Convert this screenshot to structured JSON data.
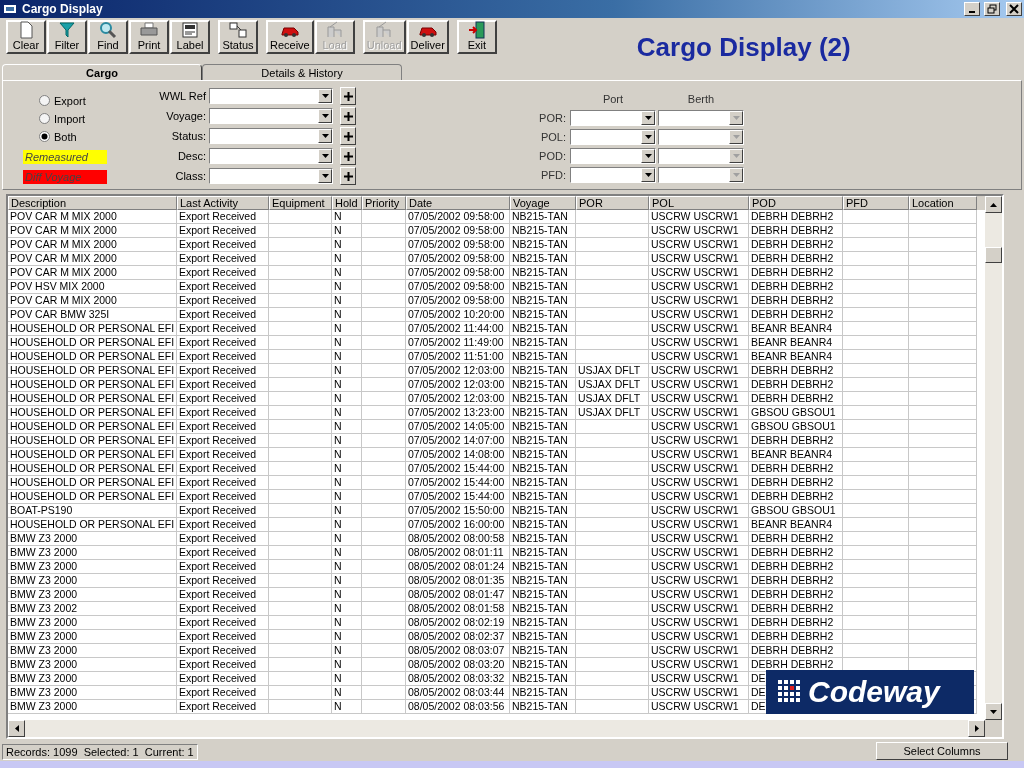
{
  "window": {
    "title": "Cargo Display"
  },
  "slide_title": "Cargo Display (2)",
  "toolbar": [
    {
      "buttons": [
        {
          "label": "Clear",
          "disabled": false
        },
        {
          "label": "Filter",
          "disabled": false
        },
        {
          "label": "Find",
          "disabled": false
        },
        {
          "label": "Print",
          "disabled": false
        },
        {
          "label": "Label",
          "disabled": false
        }
      ]
    },
    {
      "buttons": [
        {
          "label": "Status",
          "disabled": false
        }
      ]
    },
    {
      "buttons": [
        {
          "label": "Receive",
          "disabled": false
        },
        {
          "label": "Load",
          "disabled": true
        }
      ]
    },
    {
      "buttons": [
        {
          "label": "Unload",
          "disabled": true
        },
        {
          "label": "Deliver",
          "disabled": false
        }
      ]
    },
    {
      "buttons": [
        {
          "label": "Exit",
          "disabled": false
        }
      ]
    }
  ],
  "tabs": [
    {
      "label": "Cargo",
      "selected": true
    },
    {
      "label": "Details & History",
      "selected": false
    }
  ],
  "direction": [
    {
      "label": "Export",
      "selected": false
    },
    {
      "label": "Import",
      "selected": false
    },
    {
      "label": "Both",
      "selected": true
    }
  ],
  "legend": [
    {
      "label": "Remeasured",
      "color": "#ffff00"
    },
    {
      "label": "Diff Voyage",
      "color": "#ff0000"
    }
  ],
  "filters": [
    {
      "label": "WWL Ref"
    },
    {
      "label": "Voyage:"
    },
    {
      "label": "Status:"
    },
    {
      "label": "Desc:"
    },
    {
      "label": "Class:"
    }
  ],
  "ports": {
    "headers": [
      "Port",
      "Berth"
    ],
    "rows": [
      {
        "label": "POR:",
        "berth_disabled": true
      },
      {
        "label": "POL:",
        "berth_disabled": true
      },
      {
        "label": "POD:",
        "berth_disabled": true
      },
      {
        "label": "PFD:",
        "berth_disabled": true
      }
    ]
  },
  "table": {
    "columns": [
      "Description",
      "Last Activity",
      "Equipment",
      "Hold",
      "Priority",
      "Date",
      "Voyage",
      "POR",
      "POL",
      "POD",
      "PFD",
      "Location"
    ],
    "rows": [
      {
        "description": "POV CAR M MIX 2000",
        "last_activity": "Export Received",
        "hold": "N",
        "date": "07/05/2002 09:58:00",
        "voyage": "NB215-TAN",
        "pol": "USCRW USCRW1",
        "pod": "DEBRH DEBRH2"
      },
      {
        "description": "POV CAR M MIX 2000",
        "last_activity": "Export Received",
        "hold": "N",
        "date": "07/05/2002 09:58:00",
        "voyage": "NB215-TAN",
        "pol": "USCRW USCRW1",
        "pod": "DEBRH DEBRH2"
      },
      {
        "description": "POV CAR M MIX 2000",
        "last_activity": "Export Received",
        "hold": "N",
        "date": "07/05/2002 09:58:00",
        "voyage": "NB215-TAN",
        "pol": "USCRW USCRW1",
        "pod": "DEBRH DEBRH2"
      },
      {
        "description": "POV CAR M MIX 2000",
        "last_activity": "Export Received",
        "hold": "N",
        "date": "07/05/2002 09:58:00",
        "voyage": "NB215-TAN",
        "pol": "USCRW USCRW1",
        "pod": "DEBRH DEBRH2"
      },
      {
        "description": "POV CAR M MIX 2000",
        "last_activity": "Export Received",
        "hold": "N",
        "date": "07/05/2002 09:58:00",
        "voyage": "NB215-TAN",
        "pol": "USCRW USCRW1",
        "pod": "DEBRH DEBRH2"
      },
      {
        "description": "POV HSV MIX 2000",
        "last_activity": "Export Received",
        "hold": "N",
        "date": "07/05/2002 09:58:00",
        "voyage": "NB215-TAN",
        "pol": "USCRW USCRW1",
        "pod": "DEBRH DEBRH2"
      },
      {
        "description": "POV CAR M MIX 2000",
        "last_activity": "Export Received",
        "hold": "N",
        "date": "07/05/2002 09:58:00",
        "voyage": "NB215-TAN",
        "pol": "USCRW USCRW1",
        "pod": "DEBRH DEBRH2"
      },
      {
        "description": "POV CAR BMW 325I",
        "last_activity": "Export Received",
        "hold": "N",
        "date": "07/05/2002 10:20:00",
        "voyage": "NB215-TAN",
        "pol": "USCRW USCRW1",
        "pod": "DEBRH DEBRH2"
      },
      {
        "description": "HOUSEHOLD OR PERSONAL EFI",
        "last_activity": "Export Received",
        "hold": "N",
        "date": "07/05/2002 11:44:00",
        "voyage": "NB215-TAN",
        "pol": "USCRW USCRW1",
        "pod": "BEANR BEANR4"
      },
      {
        "description": "HOUSEHOLD OR PERSONAL EFI",
        "last_activity": "Export Received",
        "hold": "N",
        "date": "07/05/2002 11:49:00",
        "voyage": "NB215-TAN",
        "pol": "USCRW USCRW1",
        "pod": "BEANR BEANR4"
      },
      {
        "description": "HOUSEHOLD OR PERSONAL EFI",
        "last_activity": "Export Received",
        "hold": "N",
        "date": "07/05/2002 11:51:00",
        "voyage": "NB215-TAN",
        "pol": "USCRW USCRW1",
        "pod": "BEANR BEANR4"
      },
      {
        "description": "HOUSEHOLD OR PERSONAL EFI",
        "last_activity": "Export Received",
        "hold": "N",
        "date": "07/05/2002 12:03:00",
        "voyage": "NB215-TAN",
        "por": "USJAX DFLT",
        "pol": "USCRW USCRW1",
        "pod": "DEBRH DEBRH2"
      },
      {
        "description": "HOUSEHOLD OR PERSONAL EFI",
        "last_activity": "Export Received",
        "hold": "N",
        "date": "07/05/2002 12:03:00",
        "voyage": "NB215-TAN",
        "por": "USJAX DFLT",
        "pol": "USCRW USCRW1",
        "pod": "DEBRH DEBRH2"
      },
      {
        "description": "HOUSEHOLD OR PERSONAL EFI",
        "last_activity": "Export Received",
        "hold": "N",
        "date": "07/05/2002 12:03:00",
        "voyage": "NB215-TAN",
        "por": "USJAX DFLT",
        "pol": "USCRW USCRW1",
        "pod": "DEBRH DEBRH2"
      },
      {
        "description": "HOUSEHOLD OR PERSONAL EFI",
        "last_activity": "Export Received",
        "hold": "N",
        "date": "07/05/2002 13:23:00",
        "voyage": "NB215-TAN",
        "por": "USJAX DFLT",
        "pol": "USCRW USCRW1",
        "pod": "GBSOU GBSOU1"
      },
      {
        "description": "HOUSEHOLD OR PERSONAL EFI",
        "last_activity": "Export Received",
        "hold": "N",
        "date": "07/05/2002 14:05:00",
        "voyage": "NB215-TAN",
        "pol": "USCRW USCRW1",
        "pod": "GBSOU GBSOU1"
      },
      {
        "description": "HOUSEHOLD OR PERSONAL EFI",
        "last_activity": "Export Received",
        "hold": "N",
        "date": "07/05/2002 14:07:00",
        "voyage": "NB215-TAN",
        "pol": "USCRW USCRW1",
        "pod": "DEBRH DEBRH2"
      },
      {
        "description": "HOUSEHOLD OR PERSONAL EFI",
        "last_activity": "Export Received",
        "hold": "N",
        "date": "07/05/2002 14:08:00",
        "voyage": "NB215-TAN",
        "pol": "USCRW USCRW1",
        "pod": "BEANR BEANR4"
      },
      {
        "description": "HOUSEHOLD OR PERSONAL EFI",
        "last_activity": "Export Received",
        "hold": "N",
        "date": "07/05/2002 15:44:00",
        "voyage": "NB215-TAN",
        "pol": "USCRW USCRW1",
        "pod": "DEBRH DEBRH2"
      },
      {
        "description": "HOUSEHOLD OR PERSONAL EFI",
        "last_activity": "Export Received",
        "hold": "N",
        "date": "07/05/2002 15:44:00",
        "voyage": "NB215-TAN",
        "pol": "USCRW USCRW1",
        "pod": "DEBRH DEBRH2"
      },
      {
        "description": "HOUSEHOLD OR PERSONAL EFI",
        "last_activity": "Export Received",
        "hold": "N",
        "date": "07/05/2002 15:44:00",
        "voyage": "NB215-TAN",
        "pol": "USCRW USCRW1",
        "pod": "DEBRH DEBRH2"
      },
      {
        "description": "BOAT-PS190",
        "last_activity": "Export Received",
        "hold": "N",
        "date": "07/05/2002 15:50:00",
        "voyage": "NB215-TAN",
        "pol": "USCRW USCRW1",
        "pod": "GBSOU GBSOU1"
      },
      {
        "description": "HOUSEHOLD OR PERSONAL EFI",
        "last_activity": "Export Received",
        "hold": "N",
        "date": "07/05/2002 16:00:00",
        "voyage": "NB215-TAN",
        "pol": "USCRW USCRW1",
        "pod": "BEANR BEANR4"
      },
      {
        "description": "BMW Z3 2000",
        "last_activity": "Export Received",
        "hold": "N",
        "date": "08/05/2002 08:00:58",
        "voyage": "NB215-TAN",
        "pol": "USCRW USCRW1",
        "pod": "DEBRH DEBRH2"
      },
      {
        "description": "BMW Z3 2000",
        "last_activity": "Export Received",
        "hold": "N",
        "date": "08/05/2002 08:01:11",
        "voyage": "NB215-TAN",
        "pol": "USCRW USCRW1",
        "pod": "DEBRH DEBRH2"
      },
      {
        "description": "BMW Z3 2000",
        "last_activity": "Export Received",
        "hold": "N",
        "date": "08/05/2002 08:01:24",
        "voyage": "NB215-TAN",
        "pol": "USCRW USCRW1",
        "pod": "DEBRH DEBRH2"
      },
      {
        "description": "BMW Z3 2000",
        "last_activity": "Export Received",
        "hold": "N",
        "date": "08/05/2002 08:01:35",
        "voyage": "NB215-TAN",
        "pol": "USCRW USCRW1",
        "pod": "DEBRH DEBRH2"
      },
      {
        "description": "BMW Z3 2000",
        "last_activity": "Export Received",
        "hold": "N",
        "date": "08/05/2002 08:01:47",
        "voyage": "NB215-TAN",
        "pol": "USCRW USCRW1",
        "pod": "DEBRH DEBRH2"
      },
      {
        "description": "BMW Z3 2002",
        "last_activity": "Export Received",
        "hold": "N",
        "date": "08/05/2002 08:01:58",
        "voyage": "NB215-TAN",
        "pol": "USCRW USCRW1",
        "pod": "DEBRH DEBRH2"
      },
      {
        "description": "BMW Z3 2000",
        "last_activity": "Export Received",
        "hold": "N",
        "date": "08/05/2002 08:02:19",
        "voyage": "NB215-TAN",
        "pol": "USCRW USCRW1",
        "pod": "DEBRH DEBRH2"
      },
      {
        "description": "BMW Z3 2000",
        "last_activity": "Export Received",
        "hold": "N",
        "date": "08/05/2002 08:02:37",
        "voyage": "NB215-TAN",
        "pol": "USCRW USCRW1",
        "pod": "DEBRH DEBRH2"
      },
      {
        "description": "BMW Z3 2000",
        "last_activity": "Export Received",
        "hold": "N",
        "date": "08/05/2002 08:03:07",
        "voyage": "NB215-TAN",
        "pol": "USCRW USCRW1",
        "pod": "DEBRH DEBRH2"
      },
      {
        "description": "BMW Z3 2000",
        "last_activity": "Export Received",
        "hold": "N",
        "date": "08/05/2002 08:03:20",
        "voyage": "NB215-TAN",
        "pol": "USCRW USCRW1",
        "pod": "DEBRH DEBRH2"
      },
      {
        "description": "BMW Z3 2000",
        "last_activity": "Export Received",
        "hold": "N",
        "date": "08/05/2002 08:03:32",
        "voyage": "NB215-TAN",
        "pol": "USCRW USCRW1",
        "pod": "DE"
      },
      {
        "description": "BMW Z3 2000",
        "last_activity": "Export Received",
        "hold": "N",
        "date": "08/05/2002 08:03:44",
        "voyage": "NB215-TAN",
        "pol": "USCRW USCRW1",
        "pod": "DE"
      },
      {
        "description": "BMW Z3 2000",
        "last_activity": "Export Received",
        "hold": "N",
        "date": "08/05/2002 08:03:56",
        "voyage": "NB215-TAN",
        "pol": "USCRW USCRW1",
        "pod": "DE"
      }
    ]
  },
  "logo": {
    "text": "Codeway"
  },
  "status_bar": {
    "text": "Records: 1099  Selected: 1  Current: 1",
    "button": "Select Columns"
  }
}
